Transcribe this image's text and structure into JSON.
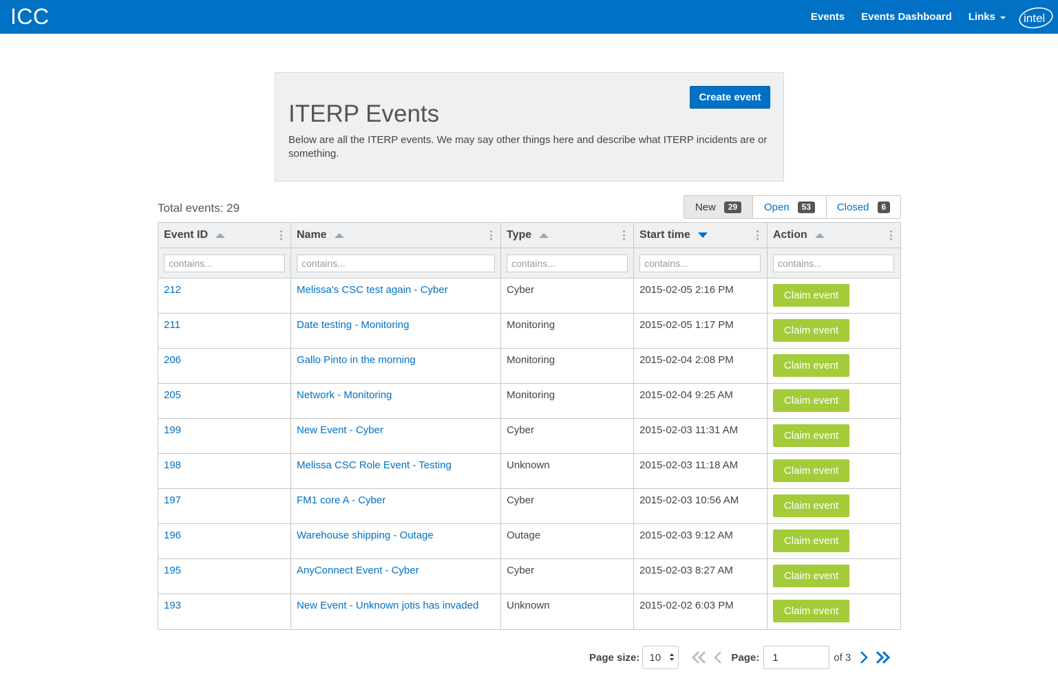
{
  "navbar": {
    "brand": "ICC",
    "links": [
      "Events",
      "Events Dashboard",
      "Links"
    ],
    "logo_text": "intel",
    "logo_icon": "intel-logo"
  },
  "jumbotron": {
    "title": "ITERP Events",
    "description": "Below are all the ITERP events. We may say other things here and describe what ITERP incidents are or something.",
    "create_button": "Create event"
  },
  "summary": {
    "total_label": "Total events: 29"
  },
  "status_tabs": [
    {
      "label": "New",
      "count": "29",
      "active": true
    },
    {
      "label": "Open",
      "count": "53",
      "active": false
    },
    {
      "label": "Closed",
      "count": "6",
      "active": false
    }
  ],
  "grid": {
    "columns": [
      {
        "label": "Event ID",
        "sort": "asc-inactive"
      },
      {
        "label": "Name",
        "sort": "asc-inactive"
      },
      {
        "label": "Type",
        "sort": "asc-inactive"
      },
      {
        "label": "Start time",
        "sort": "desc-active"
      },
      {
        "label": "Action",
        "sort": "asc-inactive"
      }
    ],
    "filter_placeholder": "contains...",
    "rows": [
      {
        "id": "212",
        "name": "Melissa's CSC test again - Cyber",
        "type": "Cyber",
        "start": "2015-02-05 2:16 PM",
        "action": "Claim event"
      },
      {
        "id": "211",
        "name": "Date testing - Monitoring",
        "type": "Monitoring",
        "start": "2015-02-05 1:17 PM",
        "action": "Claim event"
      },
      {
        "id": "206",
        "name": "Gallo Pinto in the morning",
        "type": "Monitoring",
        "start": "2015-02-04 2:08 PM",
        "action": "Claim event"
      },
      {
        "id": "205",
        "name": "Network - Monitoring",
        "type": "Monitoring",
        "start": "2015-02-04 9:25 AM",
        "action": "Claim event"
      },
      {
        "id": "199",
        "name": "New Event - Cyber",
        "type": "Cyber",
        "start": "2015-02-03 11:31 AM",
        "action": "Claim event"
      },
      {
        "id": "198",
        "name": "Melissa CSC Role Event - Testing",
        "type": "Unknown",
        "start": "2015-02-03 11:18 AM",
        "action": "Claim event"
      },
      {
        "id": "197",
        "name": "FM1 core A - Cyber",
        "type": "Cyber",
        "start": "2015-02-03 10:56 AM",
        "action": "Claim event"
      },
      {
        "id": "196",
        "name": "Warehouse shipping - Outage",
        "type": "Outage",
        "start": "2015-02-03 9:12 AM",
        "action": "Claim event"
      },
      {
        "id": "195",
        "name": "AnyConnect Event - Cyber",
        "type": "Cyber",
        "start": "2015-02-03 8:27 AM",
        "action": "Claim event"
      },
      {
        "id": "193",
        "name": "New Event - Unknown jotis has invaded",
        "type": "Unknown",
        "start": "2015-02-02 6:03 PM",
        "action": "Claim event"
      }
    ]
  },
  "pagination": {
    "page_size_label": "Page size:",
    "page_size_value": "10",
    "page_label": "Page:",
    "page_value": "1",
    "of_label": "of 3"
  },
  "colors": {
    "brand_blue": "#0071c5",
    "claim_green": "#a4cc3a",
    "panel_gray": "#eff0f2"
  }
}
